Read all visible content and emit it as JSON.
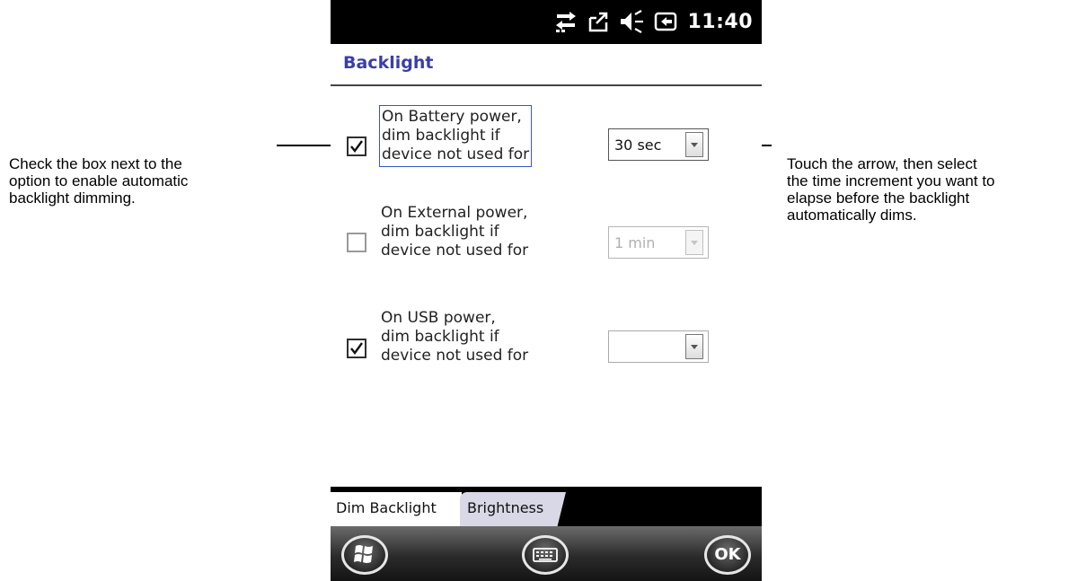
{
  "callouts": {
    "left": [
      "Check the box next to the",
      "option to enable automatic",
      "backlight dimming."
    ],
    "right": [
      "Touch the arrow, then select",
      "the time increment you want to",
      "elapse before the backlight",
      "automatically dims."
    ]
  },
  "statusbar": {
    "time": "11:40",
    "icons": [
      "connectivity-icon",
      "notification-icon",
      "speaker-icon",
      "power-icon"
    ]
  },
  "title": "Backlight",
  "rows": [
    {
      "checked": true,
      "enabled": true,
      "lines": [
        "On Battery power,",
        "dim backlight if",
        "device not used for"
      ],
      "value": "30 sec"
    },
    {
      "checked": false,
      "enabled": false,
      "lines": [
        "On External power,",
        "dim backlight if",
        "device not used for"
      ],
      "value": "1 min"
    },
    {
      "checked": true,
      "enabled": true,
      "lines": [
        "On USB power,",
        "dim backlight if",
        "device not used for"
      ],
      "value": ""
    }
  ],
  "tabs": [
    {
      "label": "Dim Backlight",
      "selected": true
    },
    {
      "label": "Brightness",
      "selected": false
    }
  ],
  "softkeys": {
    "left": "windows-start-icon",
    "center": "keyboard-icon",
    "right": "OK"
  },
  "colors": {
    "title": "#3a3fa6",
    "focus": "#3a56c8"
  }
}
